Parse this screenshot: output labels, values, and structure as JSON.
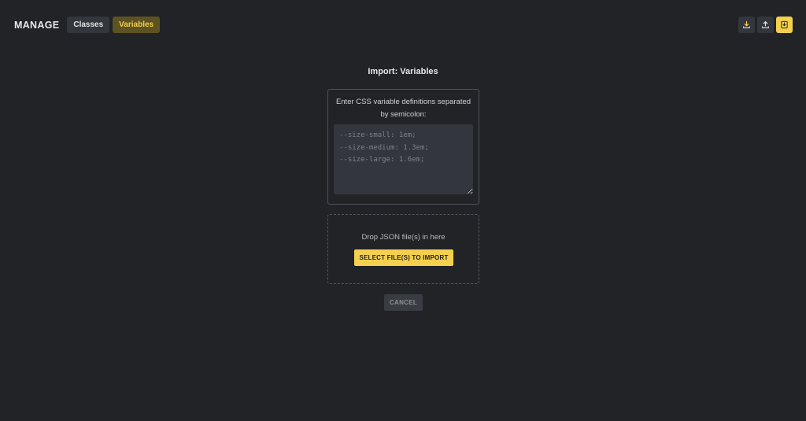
{
  "header": {
    "title": "MANAGE",
    "tabs": [
      {
        "label": "Classes",
        "active": false
      },
      {
        "label": "Variables",
        "active": true
      }
    ],
    "actions": [
      {
        "icon": "download-icon"
      },
      {
        "icon": "upload-icon"
      },
      {
        "icon": "import-file-icon",
        "active": true
      }
    ]
  },
  "import": {
    "title": "Import: Variables",
    "instructions": "Enter CSS variable definitions separated by semicolon:",
    "placeholder": "--size-small: 1em;\n--size-medium: 1.3em;\n--size-large: 1.6em;",
    "drop_text": "Drop JSON file(s) in here",
    "select_label": "SELECT FILE(S) TO IMPORT",
    "cancel_label": "CANCEL"
  },
  "colors": {
    "background": "#212327",
    "accent": "#f4d04e",
    "panel": "#33363c"
  }
}
